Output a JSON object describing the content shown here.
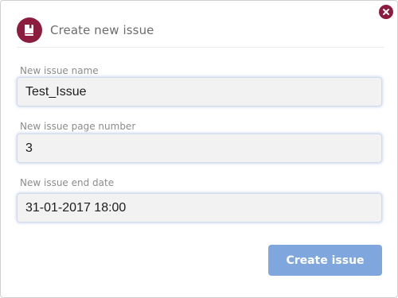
{
  "dialog": {
    "title": "Create new issue",
    "icons": {
      "header": "book-icon",
      "close": "close-icon"
    },
    "colors": {
      "accent": "#8c1d3f",
      "button": "#7fa7dd",
      "input_background": "#f2f2f2"
    }
  },
  "form": {
    "name": {
      "label": "New issue name",
      "value": "Test_Issue"
    },
    "page_number": {
      "label": "New issue page number",
      "value": "3"
    },
    "end_date": {
      "label": "New issue end date",
      "value": "31-01-2017 18:00"
    }
  },
  "actions": {
    "submit_label": "Create issue"
  }
}
